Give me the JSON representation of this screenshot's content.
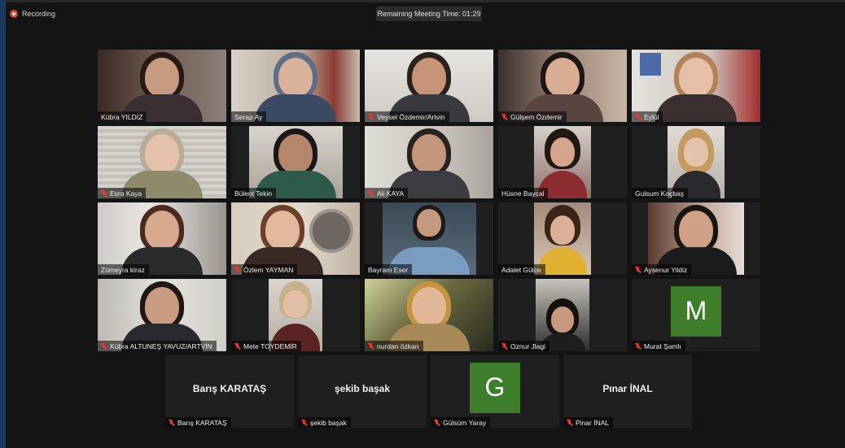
{
  "recording": {
    "label": "Recording"
  },
  "timer": {
    "label": "Remaining Meeting Time: 01:29"
  },
  "participants": [
    {
      "name": "Kübra YILDIZ",
      "muted": false,
      "active": true
    },
    {
      "name": "Serap Ay",
      "muted": false
    },
    {
      "name": "Veysel Özdemir/Artvin",
      "muted": true
    },
    {
      "name": "Gülşem Özdemir",
      "muted": true
    },
    {
      "name": "Eylül",
      "muted": true
    },
    {
      "name": "Esra Kaya",
      "muted": true
    },
    {
      "name": "Bülent Tekin",
      "muted": false
    },
    {
      "name": "Ali KAYA",
      "muted": true
    },
    {
      "name": "Hüsne Baycal",
      "muted": false
    },
    {
      "name": "Gulsum Koçbaş",
      "muted": false
    },
    {
      "name": "Zümeyra kiraz",
      "muted": false
    },
    {
      "name": "Özlem YAYMAN",
      "muted": true
    },
    {
      "name": "Bayram Eser",
      "muted": false
    },
    {
      "name": "Adalet Gülce",
      "muted": false
    },
    {
      "name": "Aysenur Yildiz",
      "muted": true
    },
    {
      "name": "Kübra ALTUNEŞ YAVUZ/ARTVİN",
      "muted": true
    },
    {
      "name": "Mete TOYDEMİR",
      "muted": true
    },
    {
      "name": "nurdan özkan",
      "muted": true
    },
    {
      "name": "Oznur Jlagi",
      "muted": true
    },
    {
      "name": "Murat Şamlı",
      "muted": true,
      "avatar": "M"
    },
    {
      "name": "Barış KARATAŞ",
      "muted": true,
      "display": "Barış KARATAŞ"
    },
    {
      "name": "şekib başak",
      "muted": true,
      "display": "şekib başak"
    },
    {
      "name": "Gülsüm Yaray",
      "muted": true,
      "avatar": "G"
    },
    {
      "name": "Pinar İNAL",
      "muted": true,
      "display": "Pınar İNAL"
    }
  ],
  "colors": {
    "avatar_bg": "#3e7d2a",
    "active_outline": "#c4d94a",
    "mute_icon": "#e33333",
    "record_dot": "#e0452b"
  }
}
